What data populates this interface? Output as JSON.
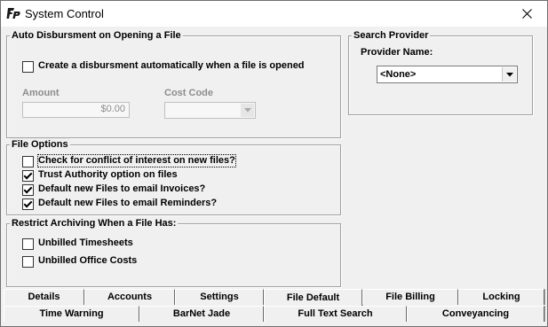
{
  "window": {
    "title": "System Control",
    "icon": "app-logo-icon",
    "close_icon": "close-icon"
  },
  "auto_disbursement": {
    "legend": "Auto Disbursment on Opening a File",
    "create_label": "Create a disbursment automatically when a file is opened",
    "create_checked": false,
    "amount_label": "Amount",
    "amount_value": "$0.00",
    "cost_code_label": "Cost Code",
    "cost_code_value": ""
  },
  "search_provider": {
    "legend": "Search Provider",
    "provider_label": "Provider Name:",
    "provider_value": "<None>"
  },
  "file_options": {
    "legend": "File Options",
    "items": [
      {
        "label": "Check for conflict of interest on new files?",
        "checked": false
      },
      {
        "label": "Trust Authority option on files",
        "checked": true
      },
      {
        "label": "Default new Files to email Invoices?",
        "checked": true
      },
      {
        "label": "Default new Files to email Reminders?",
        "checked": true
      }
    ]
  },
  "restrict_archiving": {
    "legend": "Restrict Archiving When a File Has:",
    "items": [
      {
        "label": "Unbilled Timesheets",
        "checked": false
      },
      {
        "label": "Unbilled Office Costs",
        "checked": false
      }
    ]
  },
  "tabs": {
    "row1": [
      "Details",
      "Accounts",
      "Settings",
      "File Default",
      "File Billing",
      "Locking"
    ],
    "row2": [
      "Time Warning",
      "BarNet Jade",
      "Full Text Search",
      "Conveyancing"
    ],
    "active": "File Default"
  }
}
